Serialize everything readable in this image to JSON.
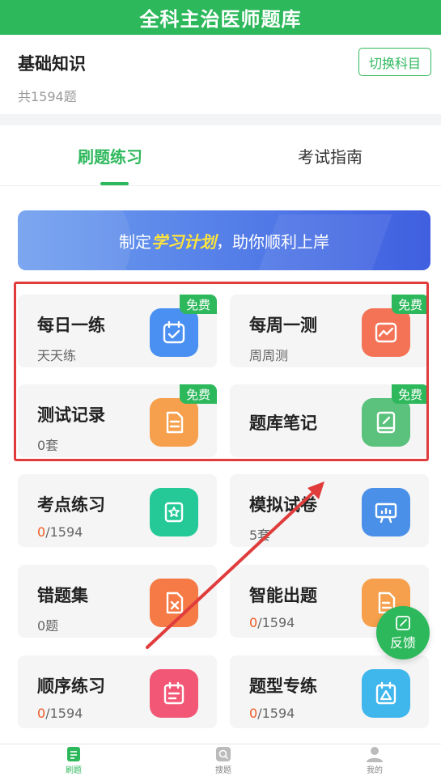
{
  "header": {
    "title": "全科主治医师题库"
  },
  "subject": {
    "name": "基础知识",
    "count_text": "共1594题",
    "switch_label": "切换科目"
  },
  "tabs": [
    {
      "label": "刷题练习",
      "active": true
    },
    {
      "label": "考试指南",
      "active": false
    }
  ],
  "banner": {
    "prefix": "制定",
    "highlight": "学习计划",
    "suffix": "，助你顺利上岸"
  },
  "cards": [
    {
      "title": "每日一练",
      "subtitle": "天天练",
      "badge": "免费",
      "icon": "calendar-check-icon",
      "color": "#4a8ff2"
    },
    {
      "title": "每周一测",
      "subtitle": "周周测",
      "badge": "免费",
      "icon": "line-chart-icon",
      "color": "#f47356"
    },
    {
      "title": "测试记录",
      "subtitle": "0套",
      "badge": "免费",
      "icon": "document-icon",
      "color": "#f6a04d"
    },
    {
      "title": "题库笔记",
      "subtitle": "",
      "badge": "免费",
      "icon": "notebook-pen-icon",
      "color": "#5ac27c"
    },
    {
      "title": "考点练习",
      "subtitle_prefix": "0",
      "subtitle_suffix": "/1594",
      "icon": "star-book-icon",
      "color": "#24c997"
    },
    {
      "title": "模拟试卷",
      "subtitle": "5套",
      "icon": "presentation-chart-icon",
      "color": "#4a90e8"
    },
    {
      "title": "错题集",
      "subtitle": "0题",
      "icon": "error-doc-icon",
      "color": "#f57a45"
    },
    {
      "title": "智能出题",
      "subtitle_prefix": "0",
      "subtitle_suffix": "/1594",
      "icon": "smart-doc-icon",
      "color": "#f6a04d"
    },
    {
      "title": "顺序练习",
      "subtitle_prefix": "0",
      "subtitle_suffix": "/1594",
      "icon": "list-calendar-icon",
      "color": "#f25876"
    },
    {
      "title": "题型专练",
      "subtitle_prefix": "0",
      "subtitle_suffix": "/1594",
      "icon": "triangle-calendar-icon",
      "color": "#3fb6ec"
    }
  ],
  "feedback": {
    "label": "反馈",
    "icon": "edit-icon"
  },
  "bottom_nav": [
    {
      "label": "刷题",
      "icon": "doc-list-icon",
      "active": true
    },
    {
      "label": "搜题",
      "icon": "search-icon",
      "active": false
    },
    {
      "label": "我的",
      "icon": "user-icon",
      "active": false
    }
  ],
  "colors": {
    "brand": "#2eb85c",
    "accent_red": "#ee5a24",
    "annotation": "#e03c3c"
  }
}
